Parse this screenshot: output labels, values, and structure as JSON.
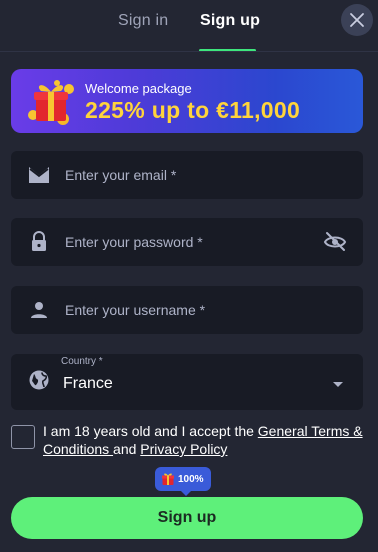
{
  "tabs": {
    "signin": "Sign in",
    "signup": "Sign up",
    "active": "signup"
  },
  "promo": {
    "subtitle": "Welcome package",
    "title": "225% up to €11,000"
  },
  "form": {
    "email_placeholder": "Enter your email *",
    "password_placeholder": "Enter your password *",
    "username_placeholder": "Enter your username *",
    "country_label": "Country *",
    "country_value": "France"
  },
  "terms": {
    "text_before": "I am 18 years old and I accept the ",
    "link_terms": "General Terms & Conditions ",
    "text_and": "and ",
    "link_privacy": "Privacy Policy",
    "checked": false
  },
  "submit": {
    "label": "Sign up",
    "badge": "100%"
  },
  "colors": {
    "accent_green": "#5ef07a",
    "tab_underline": "#3ee67d",
    "promo_yellow": "#ffd43b",
    "badge_blue": "#3a5bd9"
  },
  "icons": [
    "close-icon",
    "gift-icon",
    "email-icon",
    "lock-icon",
    "eye-off-icon",
    "user-icon",
    "globe-icon",
    "chevron-down-icon"
  ]
}
